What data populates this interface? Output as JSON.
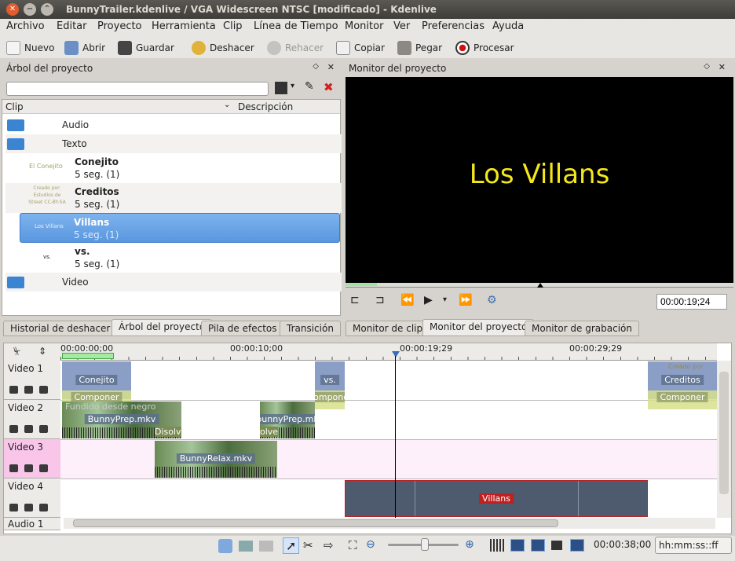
{
  "window": {
    "title": "BunnyTrailer.kdenlive / VGA Widescreen NTSC [modificado] - Kdenlive"
  },
  "menu": [
    "Archivo",
    "Editar",
    "Proyecto",
    "Herramienta",
    "Clip",
    "Línea de Tiempo",
    "Monitor",
    "Ver",
    "Preferencias",
    "Ayuda"
  ],
  "toolbar": {
    "new": "Nuevo",
    "open": "Abrir",
    "save": "Guardar",
    "undo": "Deshacer",
    "redo": "Rehacer",
    "copy": "Copiar",
    "paste": "Pegar",
    "render": "Procesar"
  },
  "project_tree": {
    "title": "Árbol del proyecto",
    "search_placeholder": "",
    "col_clip": "Clip",
    "col_desc": "Descripción",
    "items": [
      {
        "name": "Audio",
        "type": "folder"
      },
      {
        "name": "Texto",
        "type": "folder"
      },
      {
        "name": "Conejito",
        "sub": "5 seg. (1)",
        "thumb": "El Conejito"
      },
      {
        "name": "Creditos",
        "sub": "5 seg. (1)",
        "thumb": "Creado por: Estudios de Street CC-BY-SA"
      },
      {
        "name": "Villans",
        "sub": "5 seg. (1)",
        "thumb": "Los Villans",
        "selected": true
      },
      {
        "name": "vs.",
        "sub": "5 seg. (1)",
        "thumb": "vs."
      },
      {
        "name": "Video",
        "type": "folder"
      }
    ]
  },
  "monitor": {
    "title": "Monitor del proyecto",
    "text": "Los Villans",
    "timecode": "00:00:19;24"
  },
  "left_tabs": [
    "Historial de deshacer",
    "Árbol del proyecto",
    "Pila de efectos",
    "Transición"
  ],
  "right_tabs": [
    "Monitor de clip",
    "Monitor del proyecto",
    "Monitor de grabación"
  ],
  "timeline": {
    "ruler": [
      "00:00:00;00",
      "00:00:10;00",
      "00:00:19;29",
      "00:00:29;29"
    ],
    "tracks": [
      "Video 1",
      "Video 2",
      "Video 3",
      "Video 4",
      "Audio 1"
    ],
    "clips": {
      "conejito": "Conejito",
      "vs": "vs.",
      "creditos": "Creditos",
      "componer": "Componer",
      "fade": "Fundido desde negro",
      "bunnyprep": "BunnyPrep.mkv",
      "bunnyprep2": "bunnyPrep.mk",
      "disolve": "Disolve",
      "disolve2": "olve",
      "bunnyrelax": "BunnyRelax.mkv",
      "villans": "Villans",
      "creado": "Creado por:"
    }
  },
  "statusbar": {
    "duration": "00:00:38;00",
    "format": "hh:mm:ss::ff"
  },
  "colors": {
    "accent": "#5b9be0",
    "selected": "#6fa6e6",
    "record": "#d11010",
    "monitor_text": "#f5e81a",
    "track3": "#f9c6e9"
  }
}
